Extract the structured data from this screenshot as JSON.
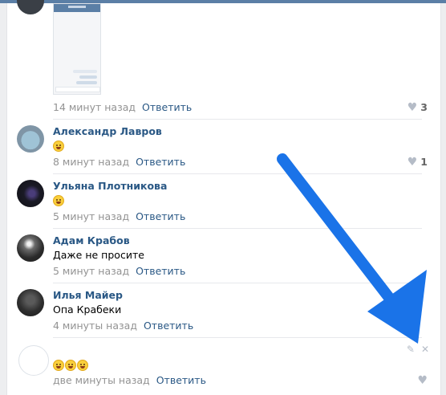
{
  "comments": [
    {
      "name": "",
      "text": "",
      "time": "14 минут назад",
      "reply": "Ответить",
      "likes": "3"
    },
    {
      "name": "Александр Лавров",
      "time": "8 минут назад",
      "reply": "Ответить",
      "likes": "1",
      "emoji": [
        "rofl-emoji"
      ]
    },
    {
      "name": "Ульяна Плотникова",
      "time": "5 минут назад",
      "reply": "Ответить",
      "likes": "",
      "emoji": [
        "rofl-emoji"
      ]
    },
    {
      "name": "Адам Крабов",
      "text": "Даже не просите",
      "time": "5 минут назад",
      "reply": "Ответить",
      "likes": ""
    },
    {
      "name": "Илья Майер",
      "text": "Опа Крабеки",
      "time": "4 минуты назад",
      "reply": "Ответить",
      "likes": ""
    },
    {
      "name": "",
      "time": "две минуты назад",
      "reply": "Ответить",
      "likes": "",
      "emoji": [
        "grin-emoji",
        "grin-emoji",
        "grin-emoji"
      ]
    }
  ],
  "icons": {
    "like": "heart-icon",
    "edit": "pencil-icon",
    "delete": "close-icon",
    "annotation": "blue-arrow"
  },
  "colors": {
    "link": "#2a5885",
    "meta": "#939393",
    "arrow": "#1a73e8",
    "header": "#5b7fa6"
  }
}
